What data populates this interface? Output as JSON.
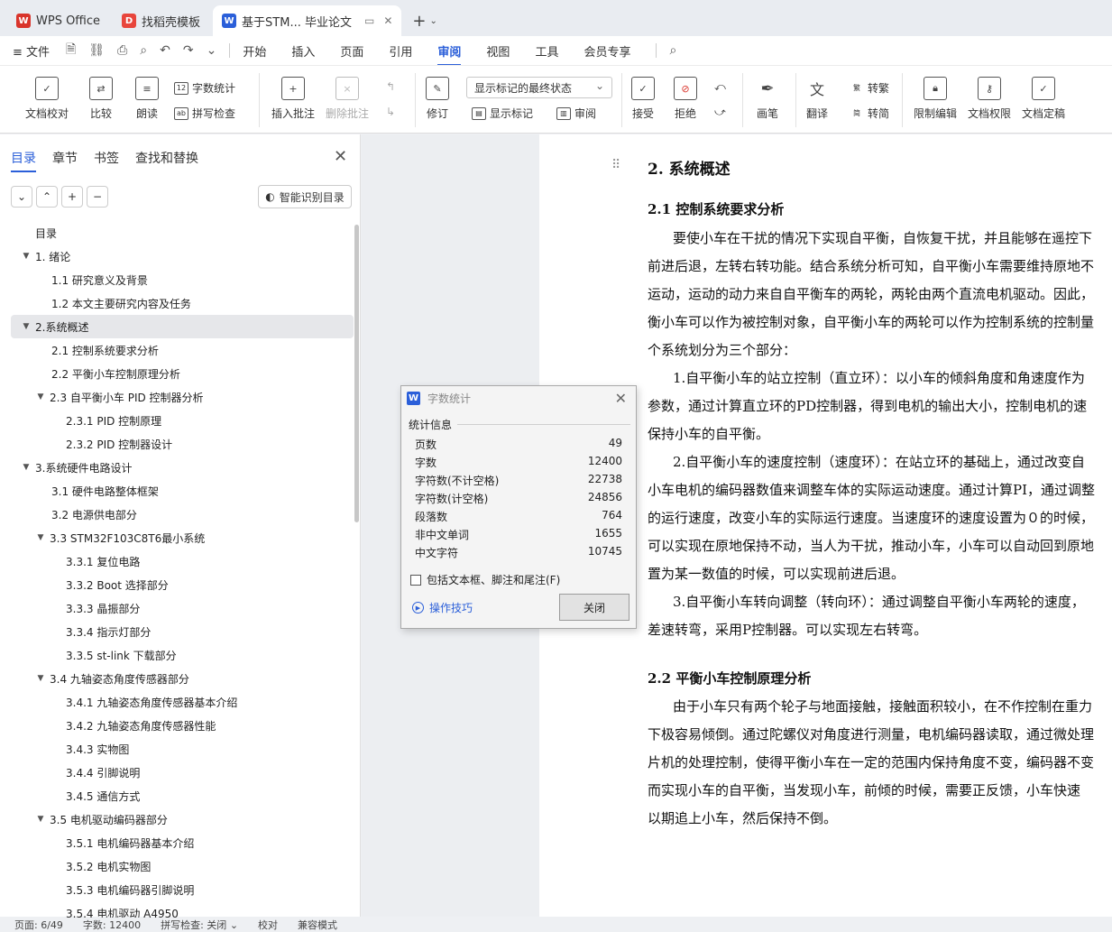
{
  "tabs": [
    {
      "label": "WPS Office",
      "icon": "wps-logo-icon",
      "active": false
    },
    {
      "label": "找稻壳模板",
      "icon": "docer-icon",
      "active": false
    },
    {
      "label": "基于STM... 毕业论文",
      "icon": "writer-doc-icon",
      "active": true
    }
  ],
  "menu": {
    "file_label": "文件",
    "items": [
      "开始",
      "插入",
      "页面",
      "引用",
      "审阅",
      "视图",
      "工具",
      "会员专享"
    ],
    "active": "审阅"
  },
  "ribbon": {
    "doc_check": "文档校对",
    "compare": "比较",
    "read_aloud": "朗读",
    "word_count": "字数统计",
    "spell_check": "拼写检查",
    "insert_comment": "插入批注",
    "delete_comment": "删除批注",
    "revise": "修订",
    "show_markup_state": "显示标记的最终状态",
    "show_markup": "显示标记",
    "review_pane": "审阅",
    "accept": "接受",
    "reject": "拒绝",
    "pen": "画笔",
    "translate": "翻译",
    "to_traditional": "转繁",
    "to_simplified": "转简",
    "restrict_edit": "限制编辑",
    "doc_permission": "文档权限",
    "doc_finalize": "文档定稿"
  },
  "nav": {
    "tabs": [
      "目录",
      "章节",
      "书签",
      "查找和替换"
    ],
    "active_tab": "目录",
    "smart_toc": "智能识别目录",
    "toc": [
      {
        "label": "目录",
        "level": 1,
        "toggle": ""
      },
      {
        "label": "1. 绪论",
        "level": 1,
        "toggle": "▼"
      },
      {
        "label": "1.1 研究意义及背景",
        "level": 2,
        "toggle": ""
      },
      {
        "label": "1.2 本文主要研究内容及任务",
        "level": 2,
        "toggle": ""
      },
      {
        "label": "2.系统概述",
        "level": 1,
        "toggle": "▼",
        "selected": true
      },
      {
        "label": "2.1 控制系统要求分析",
        "level": 2,
        "toggle": ""
      },
      {
        "label": "2.2 平衡小车控制原理分析",
        "level": 2,
        "toggle": ""
      },
      {
        "label": "2.3 自平衡小车 PID 控制器分析",
        "level": 2,
        "toggle": "▼"
      },
      {
        "label": "2.3.1 PID 控制原理",
        "level": 3,
        "toggle": ""
      },
      {
        "label": "2.3.2 PID 控制器设计",
        "level": 3,
        "toggle": ""
      },
      {
        "label": "3.系统硬件电路设计",
        "level": 1,
        "toggle": "▼"
      },
      {
        "label": "3.1 硬件电路整体框架",
        "level": 2,
        "toggle": ""
      },
      {
        "label": "3.2 电源供电部分",
        "level": 2,
        "toggle": ""
      },
      {
        "label": "3.3 STM32F103C8T6最小系统",
        "level": 2,
        "toggle": "▼"
      },
      {
        "label": "3.3.1 复位电路",
        "level": 3,
        "toggle": ""
      },
      {
        "label": "3.3.2 Boot 选择部分",
        "level": 3,
        "toggle": ""
      },
      {
        "label": "3.3.3 晶振部分",
        "level": 3,
        "toggle": ""
      },
      {
        "label": "3.3.4 指示灯部分",
        "level": 3,
        "toggle": ""
      },
      {
        "label": "3.3.5 st-link 下载部分",
        "level": 3,
        "toggle": ""
      },
      {
        "label": "3.4 九轴姿态角度传感器部分",
        "level": 2,
        "toggle": "▼"
      },
      {
        "label": "3.4.1 九轴姿态角度传感器基本介绍",
        "level": 3,
        "toggle": ""
      },
      {
        "label": "3.4.2 九轴姿态角度传感器性能",
        "level": 3,
        "toggle": ""
      },
      {
        "label": "3.4.3 实物图",
        "level": 3,
        "toggle": ""
      },
      {
        "label": "3.4.4 引脚说明",
        "level": 3,
        "toggle": ""
      },
      {
        "label": "3.4.5 通信方式",
        "level": 3,
        "toggle": ""
      },
      {
        "label": "3.5 电机驱动编码器部分",
        "level": 2,
        "toggle": "▼"
      },
      {
        "label": "3.5.1 电机编码器基本介绍",
        "level": 3,
        "toggle": ""
      },
      {
        "label": "3.5.2 电机实物图",
        "level": 3,
        "toggle": ""
      },
      {
        "label": "3.5.3 电机编码器引脚说明",
        "level": 3,
        "toggle": ""
      },
      {
        "label": "3.5.4 电机驱动 A4950",
        "level": 3,
        "toggle": ""
      }
    ]
  },
  "document": {
    "h1": "2.  系统概述",
    "h2_1": "2.1  控制系统要求分析",
    "p1": [
      "要使小车在干扰的情况下实现自平衡，自恢复干扰，并且能够在遥控下",
      "前进后退，左转右转功能。结合系统分析可知，自平衡小车需要维持原地不",
      "运动，运动的动力来自自平衡车的两轮，两轮由两个直流电机驱动。因此，",
      "衡小车可以作为被控制对象，自平衡小车的两轮可以作为控制系统的控制量",
      "个系统划分为三个部分："
    ],
    "p2": [
      "1.自平衡小车的站立控制（直立环）：以小车的倾斜角度和角速度作为",
      "参数，通过计算直立环的PD控制器，得到电机的输出大小，控制电机的速",
      "保持小车的自平衡。"
    ],
    "p3": [
      "2.自平衡小车的速度控制（速度环）：在站立环的基础上，通过改变自",
      "小车电机的编码器数值来调整车体的实际运动速度。通过计算PI，通过调整",
      "的运行速度，改变小车的实际运行速度。当速度环的速度设置为０的时候，",
      "可以实现在原地保持不动，当人为干扰，推动小车，小车可以自动回到原地",
      "置为某一数值的时候，可以实现前进后退。"
    ],
    "p4": [
      "3.自平衡小车转向调整（转向环）：通过调整自平衡小车两轮的速度，",
      "差速转弯，采用P控制器。可以实现左右转弯。"
    ],
    "h2_2": "2.2  平衡小车控制原理分析",
    "p5": [
      "由于小车只有两个轮子与地面接触，接触面积较小，在不作控制在重力",
      "下极容易倾倒。通过陀螺仪对角度进行测量，电机编码器读取，通过微处理",
      "片机的处理控制，使得平衡小车在一定的范围内保持角度不变，编码器不变",
      "而实现小车的自平衡，当发现小车，前倾的时候，需要正反馈，小车快速",
      "以期追上小车，然后保持不倒。"
    ]
  },
  "dialog": {
    "title": "字数统计",
    "section": "统计信息",
    "rows": [
      {
        "label": "页数",
        "value": "49"
      },
      {
        "label": "字数",
        "value": "12400"
      },
      {
        "label": "字符数(不计空格)",
        "value": "22738"
      },
      {
        "label": "字符数(计空格)",
        "value": "24856"
      },
      {
        "label": "段落数",
        "value": "764"
      },
      {
        "label": "非中文单词",
        "value": "1655"
      },
      {
        "label": "中文字符",
        "value": "10745"
      }
    ],
    "checkbox_label": "包括文本框、脚注和尾注(F)",
    "tips_label": "操作技巧",
    "close_label": "关闭"
  },
  "status": {
    "page": "页面: 6/49",
    "words": "字数: 12400",
    "spell": "拼写检查: 关闭",
    "proof": "校对",
    "compat": "兼容模式"
  },
  "colors": {
    "accent": "#2b5fd9",
    "wps_red": "#d9342b"
  }
}
